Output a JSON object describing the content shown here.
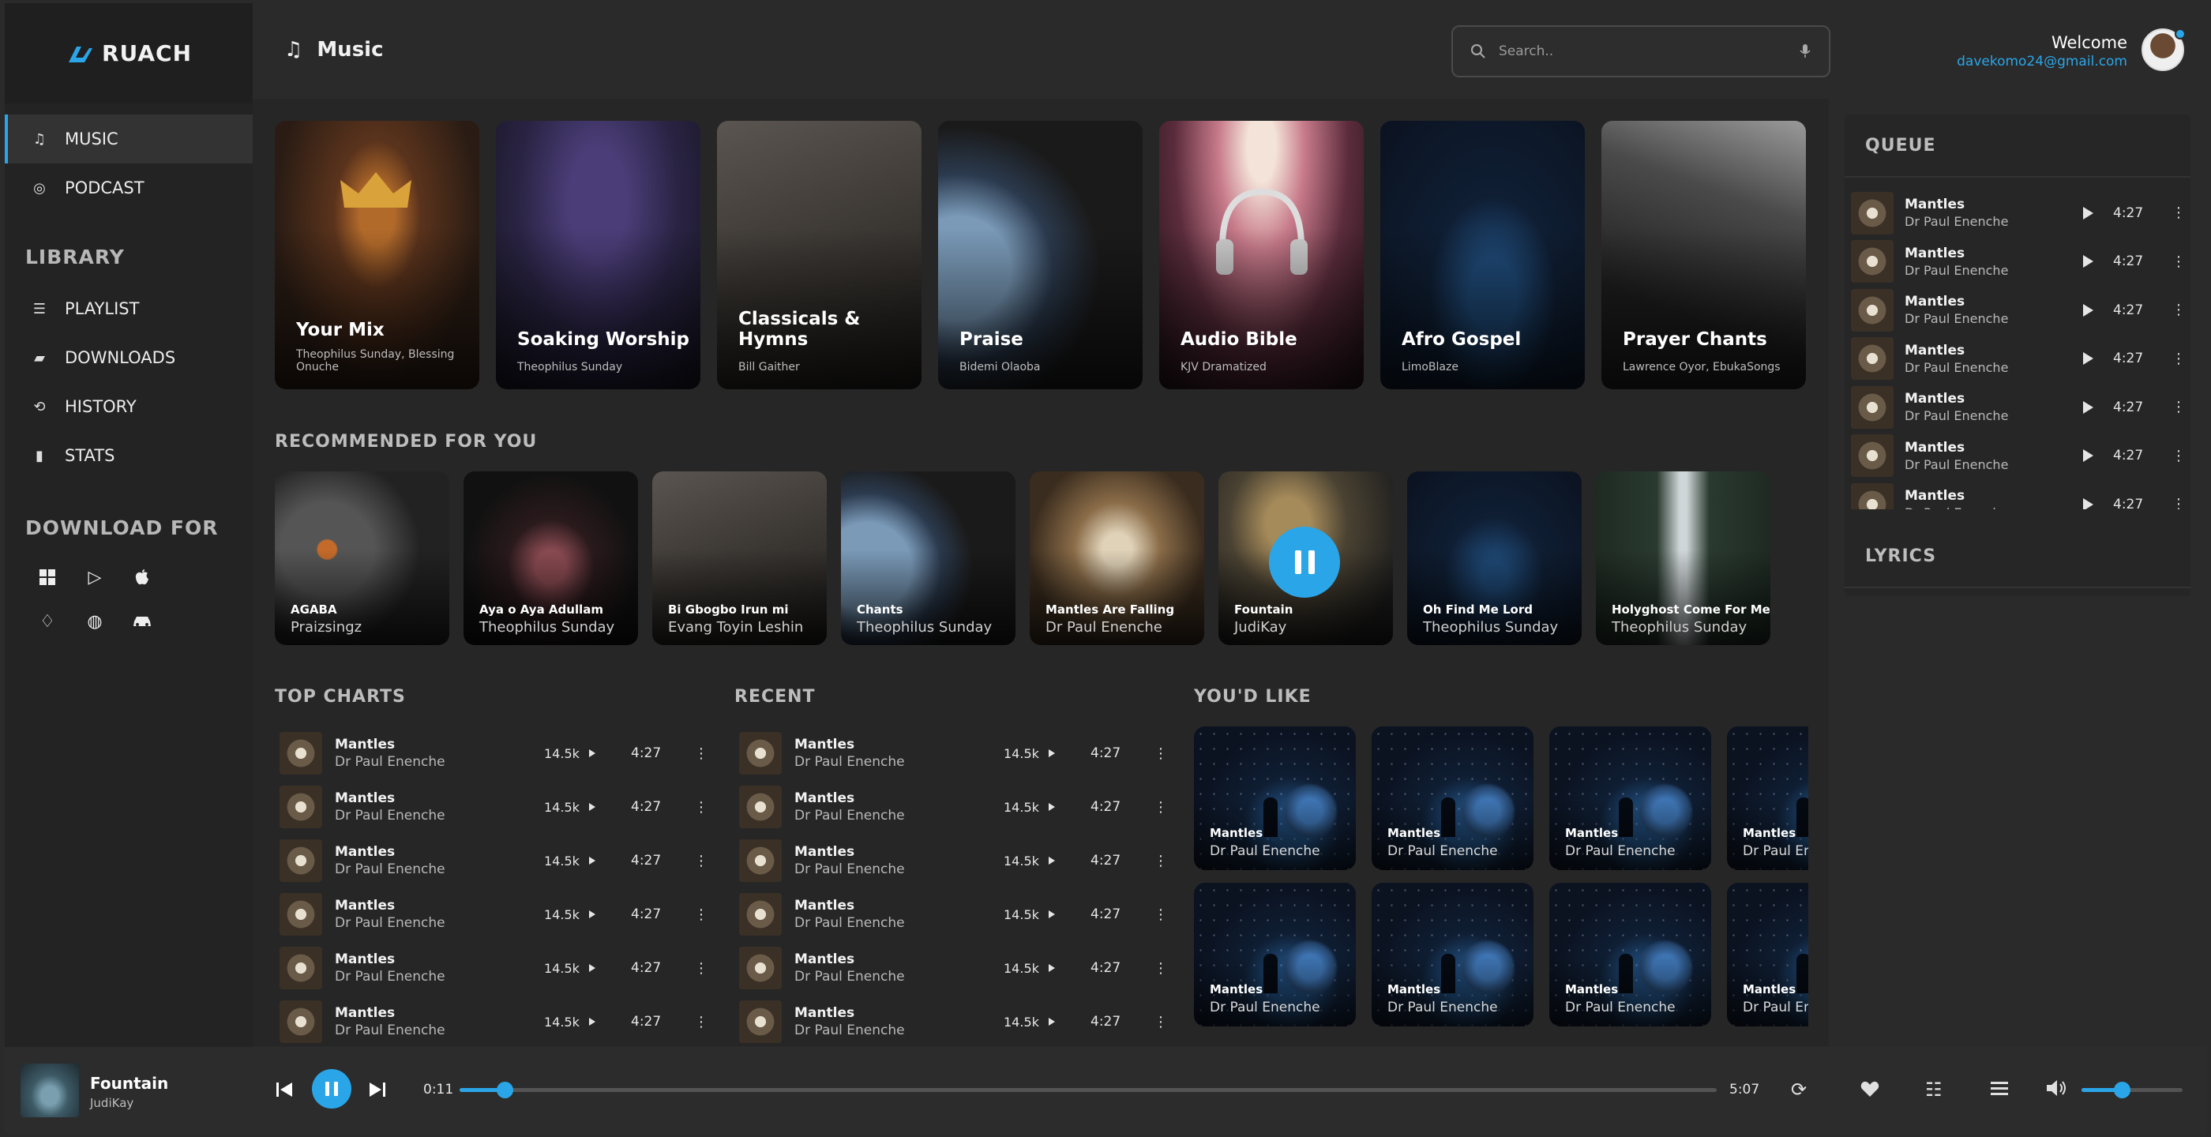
{
  "app": {
    "brand": "RUACH"
  },
  "sidebar": {
    "nav": [
      {
        "label": "MUSIC",
        "icon": "music-note-icon",
        "active": true
      },
      {
        "label": "PODCAST",
        "icon": "podcast-icon",
        "active": false
      }
    ],
    "library_heading": "LIBRARY",
    "library": [
      {
        "label": "PLAYLIST",
        "icon": "playlist-icon"
      },
      {
        "label": "DOWNLOADS",
        "icon": "download-folder-icon"
      },
      {
        "label": "HISTORY",
        "icon": "history-icon"
      },
      {
        "label": "STATS",
        "icon": "stats-icon"
      }
    ],
    "download_heading": "DOWNLOAD FOR",
    "platforms": [
      "windows-icon",
      "google-play-icon",
      "apple-icon",
      "playstation-icon",
      "smartwatch-icon",
      "car-icon"
    ]
  },
  "header": {
    "title": "Music",
    "search_placeholder": "Search..",
    "welcome": "Welcome",
    "email": "davekomo24@gmail.com"
  },
  "featured": [
    {
      "title": "Your Mix",
      "subtitle": "Theophilus Sunday, Blessing Onuche"
    },
    {
      "title": "Soaking Worship",
      "subtitle": "Theophilus Sunday"
    },
    {
      "title": "Classicals & Hymns",
      "subtitle": "Bill Gaither"
    },
    {
      "title": "Praise",
      "subtitle": "Bidemi Olaoba"
    },
    {
      "title": "Audio Bible",
      "subtitle": "KJV Dramatized"
    },
    {
      "title": "Afro Gospel",
      "subtitle": "LimoBlaze"
    },
    {
      "title": "Prayer Chants",
      "subtitle": "Lawrence Oyor, EbukaSongs"
    }
  ],
  "recommended_heading": "RECOMMENDED FOR YOU",
  "recommended": [
    {
      "title": "AGABA",
      "artist": "Praizsingz"
    },
    {
      "title": "Aya o Aya Adullam",
      "artist": "Theophilus Sunday"
    },
    {
      "title": "Bi Gbogbo Irun mi",
      "artist": "Evang Toyin Leshin"
    },
    {
      "title": "Chants",
      "artist": "Theophilus Sunday"
    },
    {
      "title": "Mantles Are Falling",
      "artist": "Dr Paul Enenche"
    },
    {
      "title": "Fountain",
      "artist": "JudiKay"
    },
    {
      "title": "Oh Find Me Lord",
      "artist": "Theophilus Sunday"
    },
    {
      "title": "Holyghost Come For Me",
      "artist": "Theophilus Sunday"
    }
  ],
  "top_charts": {
    "heading": "TOP CHARTS",
    "rows": [
      {
        "title": "Mantles",
        "artist": "Dr Paul Enenche",
        "plays": "14.5k",
        "duration": "4:27"
      },
      {
        "title": "Mantles",
        "artist": "Dr Paul Enenche",
        "plays": "14.5k",
        "duration": "4:27"
      },
      {
        "title": "Mantles",
        "artist": "Dr Paul Enenche",
        "plays": "14.5k",
        "duration": "4:27"
      },
      {
        "title": "Mantles",
        "artist": "Dr Paul Enenche",
        "plays": "14.5k",
        "duration": "4:27"
      },
      {
        "title": "Mantles",
        "artist": "Dr Paul Enenche",
        "plays": "14.5k",
        "duration": "4:27"
      },
      {
        "title": "Mantles",
        "artist": "Dr Paul Enenche",
        "plays": "14.5k",
        "duration": "4:27"
      }
    ]
  },
  "recent": {
    "heading": "RECENT",
    "rows": [
      {
        "title": "Mantles",
        "artist": "Dr Paul Enenche",
        "plays": "14.5k",
        "duration": "4:27"
      },
      {
        "title": "Mantles",
        "artist": "Dr Paul Enenche",
        "plays": "14.5k",
        "duration": "4:27"
      },
      {
        "title": "Mantles",
        "artist": "Dr Paul Enenche",
        "plays": "14.5k",
        "duration": "4:27"
      },
      {
        "title": "Mantles",
        "artist": "Dr Paul Enenche",
        "plays": "14.5k",
        "duration": "4:27"
      },
      {
        "title": "Mantles",
        "artist": "Dr Paul Enenche",
        "plays": "14.5k",
        "duration": "4:27"
      },
      {
        "title": "Mantles",
        "artist": "Dr Paul Enenche",
        "plays": "14.5k",
        "duration": "4:27"
      }
    ]
  },
  "youd_like": {
    "heading": "YOU'D LIKE",
    "cards": [
      {
        "title": "Mantles",
        "artist": "Dr Paul Enenche"
      },
      {
        "title": "Mantles",
        "artist": "Dr Paul Enenche"
      },
      {
        "title": "Mantles",
        "artist": "Dr Paul Enenche"
      },
      {
        "title": "Mantles",
        "artist": "Dr Paul Enenche"
      },
      {
        "title": "Mantles",
        "artist": "Dr Paul Enenche"
      },
      {
        "title": "Mantles",
        "artist": "Dr Paul Enenche"
      },
      {
        "title": "Mantles",
        "artist": "Dr Paul Enenche"
      },
      {
        "title": "Mantles",
        "artist": "Dr Paul Enenche"
      }
    ]
  },
  "queue": {
    "heading": "QUEUE",
    "rows": [
      {
        "title": "Mantles",
        "artist": "Dr Paul Enenche",
        "duration": "4:27"
      },
      {
        "title": "Mantles",
        "artist": "Dr Paul Enenche",
        "duration": "4:27"
      },
      {
        "title": "Mantles",
        "artist": "Dr Paul Enenche",
        "duration": "4:27"
      },
      {
        "title": "Mantles",
        "artist": "Dr Paul Enenche",
        "duration": "4:27"
      },
      {
        "title": "Mantles",
        "artist": "Dr Paul Enenche",
        "duration": "4:27"
      },
      {
        "title": "Mantles",
        "artist": "Dr Paul Enenche",
        "duration": "4:27"
      },
      {
        "title": "Mantles",
        "artist": "Dr Paul Enenche",
        "duration": "4:27"
      }
    ]
  },
  "lyrics_heading": "LYRICS",
  "player": {
    "title": "Fountain",
    "artist": "JudiKay",
    "elapsed": "0:11",
    "total": "5:07",
    "progress_fraction": 0.036,
    "volume_fraction": 0.4,
    "accent": "#2aa6e8"
  }
}
